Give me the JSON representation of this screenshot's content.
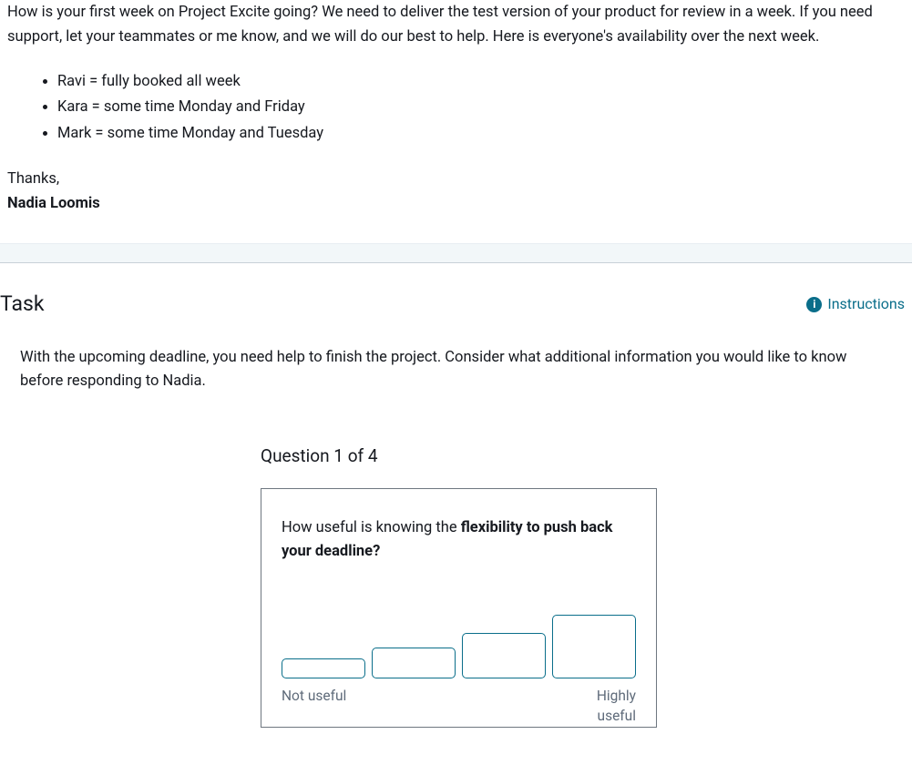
{
  "email": {
    "body": "How is your first week on Project Excite going? We need to deliver the test version of your product for review in a week. If you need support, let your teammates or me know, and we will do our best to help. Here is everyone's availability over the next week.",
    "availability": [
      "Ravi = fully booked all week",
      "Kara = some time Monday and Friday",
      "Mark = some time Monday and Tuesday"
    ],
    "signoff": "Thanks,",
    "signoff_name": "Nadia Loomis"
  },
  "task": {
    "heading": "Task",
    "instructions_label": "Instructions",
    "prompt": "With the upcoming deadline, you need help to finish the project. Consider what additional information you would like to know before responding to Nadia."
  },
  "question": {
    "counter": "Question 1 of 4",
    "text_prefix": "How useful is knowing the ",
    "text_bold": "flexibility to push back your deadline?",
    "label_low": "Not useful",
    "label_high_line1": "Highly",
    "label_high_line2": "useful"
  }
}
